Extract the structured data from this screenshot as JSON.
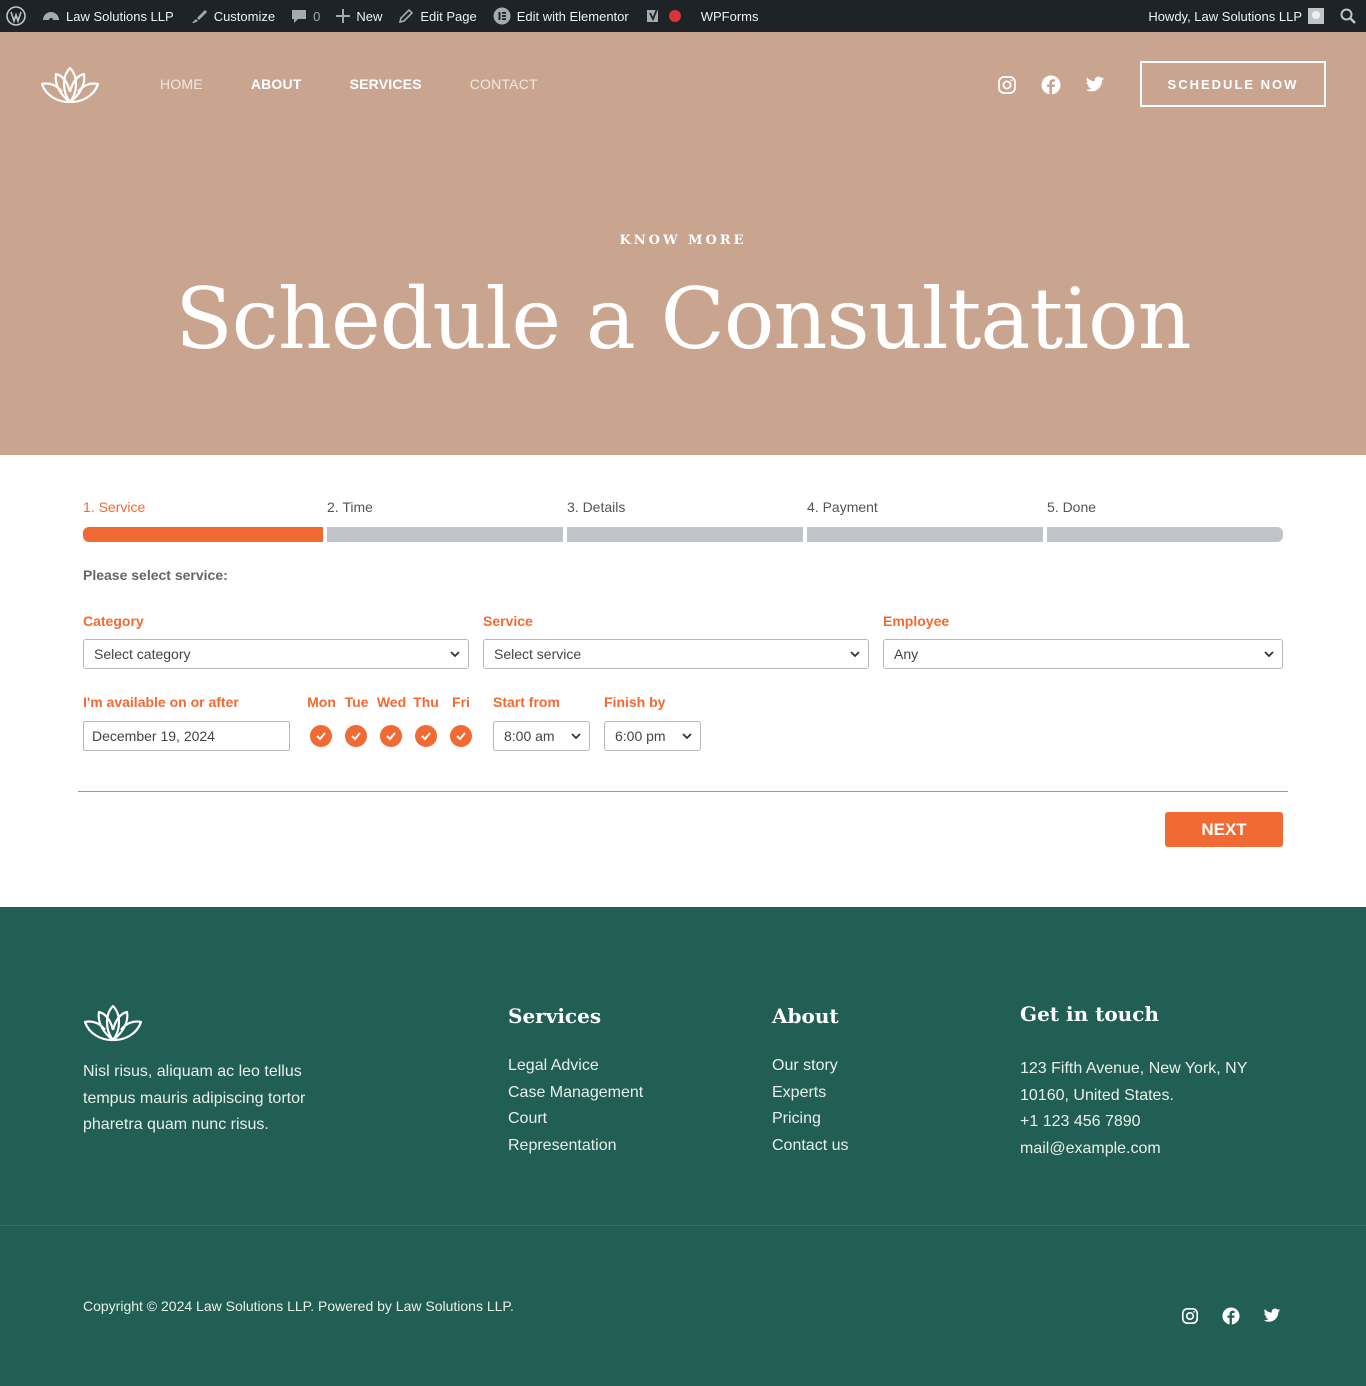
{
  "admin_bar": {
    "site_name": "Law Solutions LLP",
    "customize": "Customize",
    "comments_count": "0",
    "new": "New",
    "edit_page": "Edit Page",
    "edit_elementor": "Edit with Elementor",
    "wpforms": "WPForms",
    "howdy": "Howdy, Law Solutions LLP"
  },
  "header": {
    "nav": [
      "HOME",
      "ABOUT",
      "SERVICES",
      "CONTACT"
    ],
    "cta": "SCHEDULE NOW",
    "socials": [
      "instagram-icon",
      "facebook-icon",
      "twitter-icon"
    ]
  },
  "hero": {
    "eyebrow": "KNOW MORE",
    "title": "Schedule a Consultation"
  },
  "booking": {
    "steps": [
      "1. Service",
      "2. Time",
      "3. Details",
      "4. Payment",
      "5. Done"
    ],
    "active_step": 1,
    "prompt": "Please select service:",
    "category": {
      "label": "Category",
      "value": "Select category"
    },
    "service": {
      "label": "Service",
      "value": "Select service"
    },
    "employee": {
      "label": "Employee",
      "value": "Any"
    },
    "availability": {
      "label": "I'm available on or after",
      "date": "December 19, 2024"
    },
    "days": [
      "Mon",
      "Tue",
      "Wed",
      "Thu",
      "Fri"
    ],
    "start_from": {
      "label": "Start from",
      "value": "8:00 am"
    },
    "finish_by": {
      "label": "Finish by",
      "value": "6:00 pm"
    },
    "next": "NEXT"
  },
  "footer": {
    "about_text": "Nisl risus, aliquam ac leo tellus tempus mauris adipiscing tortor pharetra quam nunc risus.",
    "services_heading": "Services",
    "services": [
      "Legal Advice",
      "Case Management",
      "Court",
      "Representation"
    ],
    "about_heading": "About",
    "about_links": [
      "Our story",
      "Experts",
      "Pricing",
      "Contact us"
    ],
    "contact_heading": "Get in touch",
    "address_line1": "123 Fifth Avenue, New York, NY",
    "address_line2": "10160, United States.",
    "phone": "+1 123 456 7890",
    "email": "mail@example.com",
    "copyright": "Copyright © 2024 Law Solutions LLP. Powered by Law Solutions LLP."
  },
  "colors": {
    "hero_bg": "#c9a590",
    "accent": "#f26a33",
    "footer_bg": "#215e54",
    "admin_bar": "#1d2327"
  }
}
